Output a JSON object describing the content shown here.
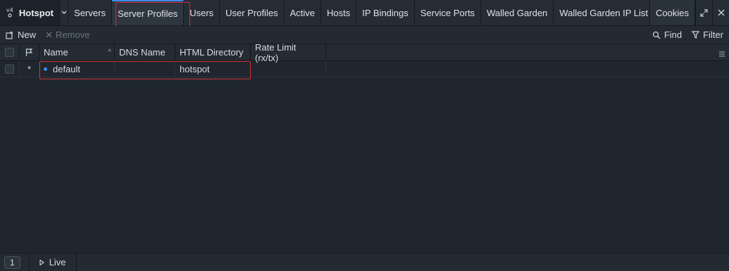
{
  "app": {
    "title": "Hotspot"
  },
  "tabs": [
    {
      "label": "Servers",
      "active": false
    },
    {
      "label": "Server Profiles",
      "active": true
    },
    {
      "label": "Users",
      "active": false
    },
    {
      "label": "User Profiles",
      "active": false
    },
    {
      "label": "Active",
      "active": false
    },
    {
      "label": "Hosts",
      "active": false
    },
    {
      "label": "IP Bindings",
      "active": false
    },
    {
      "label": "Service Ports",
      "active": false
    },
    {
      "label": "Walled Garden",
      "active": false
    },
    {
      "label": "Walled Garden IP List",
      "active": false
    },
    {
      "label": "Cookies",
      "active": false
    }
  ],
  "toolbar": {
    "new_label": "New",
    "remove_label": "Remove",
    "find_label": "Find",
    "filter_label": "Filter"
  },
  "table": {
    "columns": [
      "Name",
      "DNS Name",
      "HTML Directory",
      "Rate Limit (rx/tx)"
    ],
    "rows": [
      {
        "flag": "*",
        "name": "default",
        "dns_name": "",
        "html_directory": "hotspot",
        "rate_limit": ""
      }
    ]
  },
  "status": {
    "count": "1",
    "live_label": "Live"
  },
  "colors": {
    "accent": "#3b8eea",
    "highlight": "#d0303a",
    "background": "#1f262e"
  }
}
